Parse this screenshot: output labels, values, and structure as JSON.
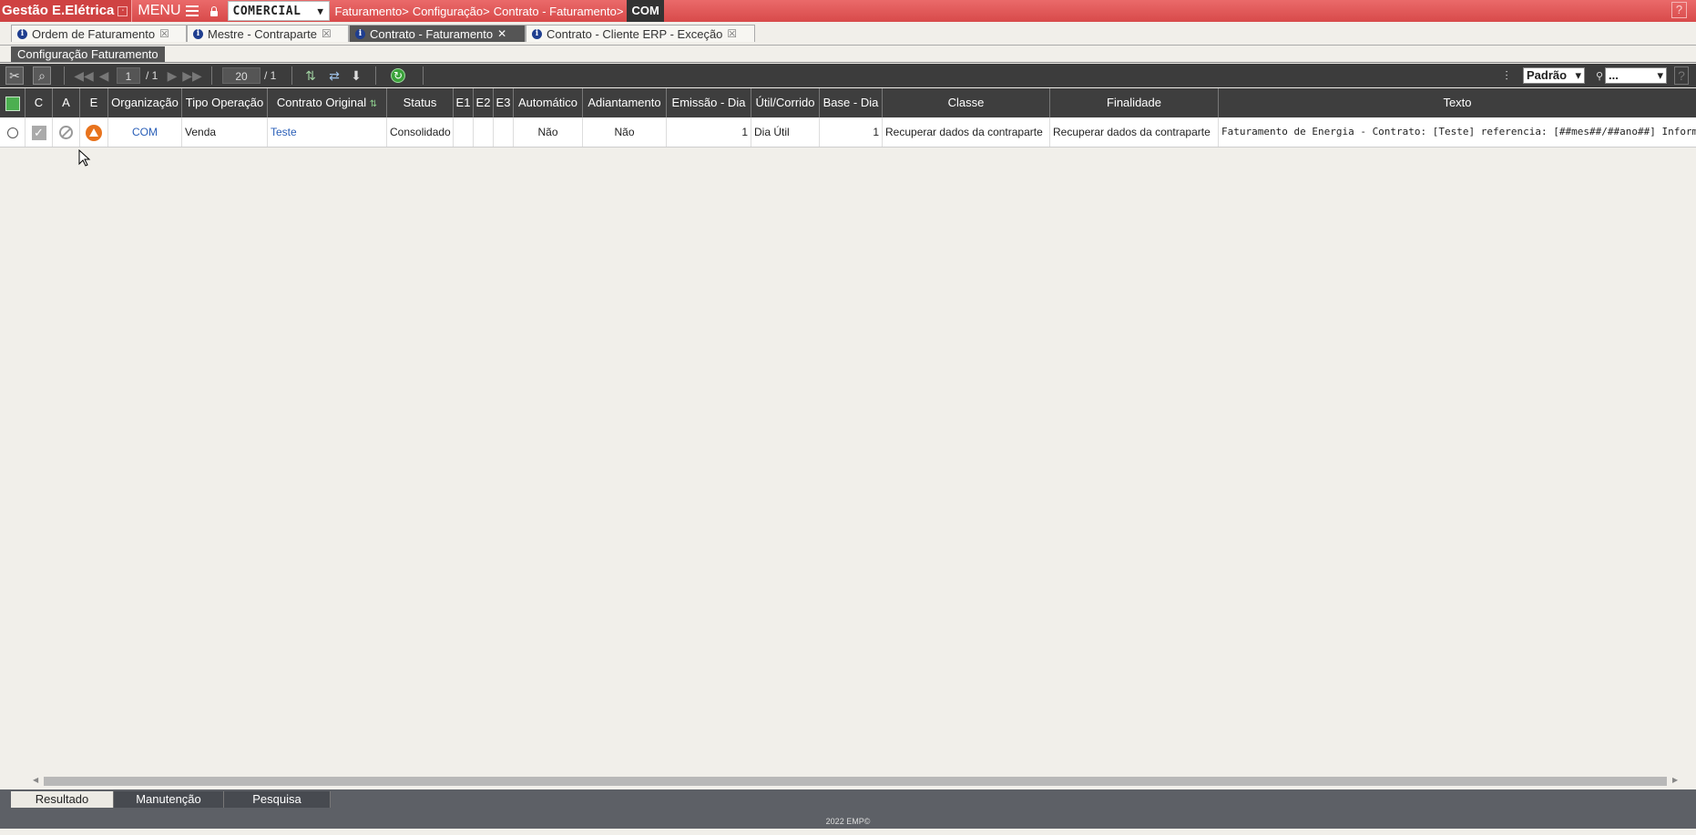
{
  "topbar": {
    "app_title": "Gestão E.Elétrica",
    "minimize_glyph": "-",
    "menu_label": "MENU",
    "module": "COMERCIAL",
    "breadcrumb": [
      "Faturamento>",
      "Configuração>",
      "Contrato - Faturamento>"
    ],
    "breadcrumb_current": "COM",
    "help_glyph": "?"
  },
  "tabs": [
    {
      "label": "Ordem de Faturamento",
      "active": false
    },
    {
      "label": "Mestre - Contraparte",
      "active": false
    },
    {
      "label": "Contrato - Faturamento",
      "active": true
    },
    {
      "label": "Contrato - Cliente ERP - Exceção",
      "active": false
    }
  ],
  "subtab": "Configuração Faturamento",
  "toolbar": {
    "page_current": "1",
    "page_total": "/ 1",
    "page_size": "20",
    "page_size_total": "/ 1",
    "view_select": "Padrão",
    "filter_select": "...",
    "help_glyph": "?"
  },
  "grid": {
    "columns": [
      "C",
      "A",
      "E",
      "Organização",
      "Tipo Operação",
      "Contrato Original",
      "Status",
      "E1",
      "E2",
      "E3",
      "Automático",
      "Adiantamento",
      "Emissão - Dia",
      "Útil/Corrido",
      "Base - Dia",
      "Classe",
      "Finalidade",
      "Texto"
    ],
    "rows": [
      {
        "organizacao": "COM",
        "tipo_operacao": "Venda",
        "contrato_original": "Teste",
        "status": "Consolidado",
        "e1": "",
        "e2": "",
        "e3": "",
        "automatico": "Não",
        "adiantamento": "Não",
        "emissao_dia": "1",
        "util_corrido": "Dia Útil",
        "base_dia": "1",
        "classe": "Recuperar dados da contraparte",
        "finalidade": "Recuperar dados da contraparte",
        "texto": "Faturamento de Energia - Contrato: [Teste] referencia: [##mes##/##ano##] Informação ac"
      }
    ]
  },
  "bottom_tabs": [
    "Resultado",
    "Manutenção",
    "Pesquisa"
  ],
  "footer": "2022 EMP©",
  "icons": {
    "check": "✓",
    "close": "✕",
    "refresh": "↻",
    "search": "🔍",
    "arrow_down": "▾"
  }
}
